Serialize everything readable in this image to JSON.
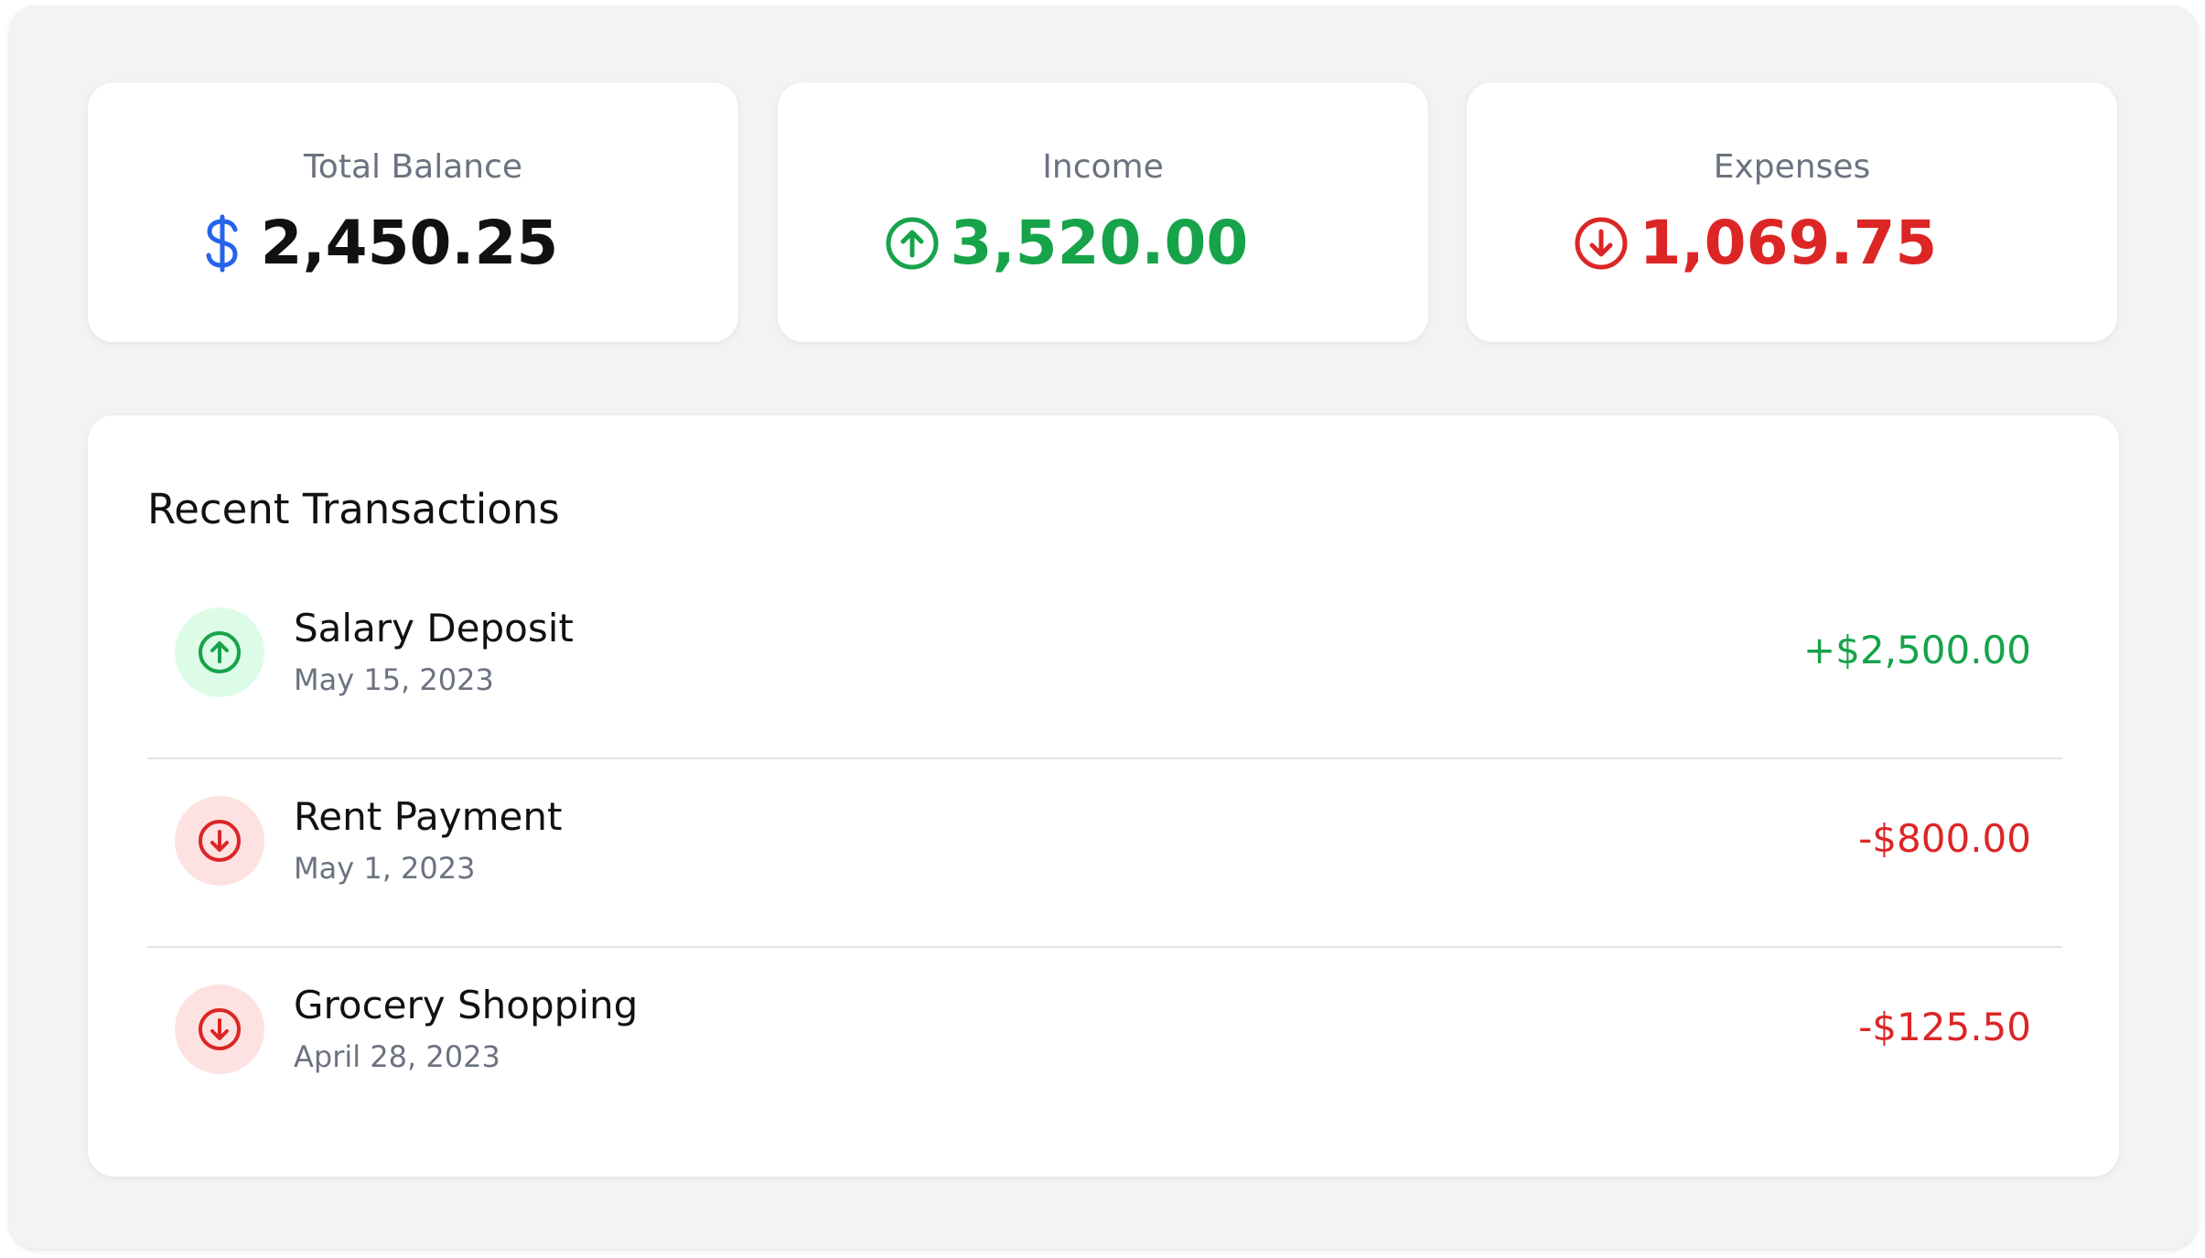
{
  "colors": {
    "background": "#f2f3f5",
    "card": "#ffffff",
    "blue_accent": "#2563eb",
    "green": "#16a34a",
    "red": "#dc2626",
    "green_soft": "#dcfce7",
    "red_soft": "#fee2e2",
    "muted_text": "#6b7280"
  },
  "summary": {
    "balance": {
      "label": "Total Balance",
      "value": "2,450.25",
      "icon": "dollar-icon"
    },
    "income": {
      "label": "Income",
      "value": "3,520.00",
      "icon": "arrow-up-circle-icon"
    },
    "expenses": {
      "label": "Expenses",
      "value": "1,069.75",
      "icon": "arrow-down-circle-icon"
    }
  },
  "transactions": {
    "title": "Recent Transactions",
    "items": [
      {
        "name": "Salary Deposit",
        "date": "May 15, 2023",
        "amount": "+$2,500.00",
        "type": "income",
        "icon": "arrow-up-circle-icon"
      },
      {
        "name": "Rent Payment",
        "date": "May 1, 2023",
        "amount": "-$800.00",
        "type": "expense",
        "icon": "arrow-down-circle-icon"
      },
      {
        "name": "Grocery Shopping",
        "date": "April 28, 2023",
        "amount": "-$125.50",
        "type": "expense",
        "icon": "arrow-down-circle-icon"
      }
    ]
  }
}
